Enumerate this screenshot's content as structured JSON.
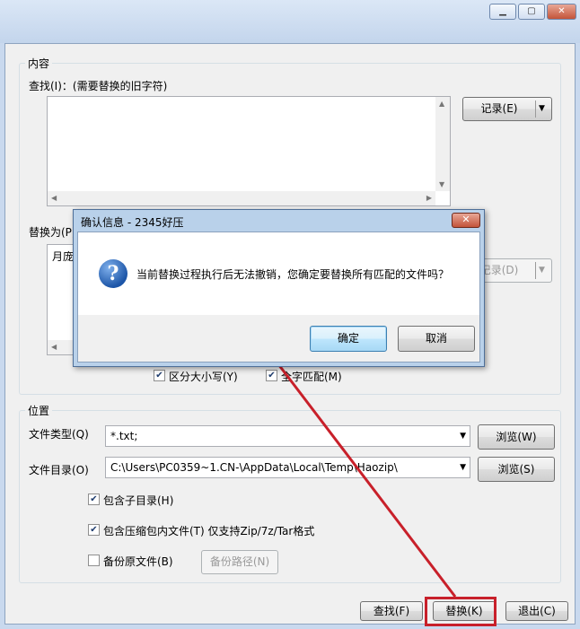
{
  "window": {
    "minimize_glyph": "▁",
    "maximize_glyph": "▢",
    "close_glyph": "✕"
  },
  "content": {
    "group_title": "内容",
    "find_label": "查找(I)：(需要替换的旧字符)",
    "find_history_button": "记录(E)",
    "replace_label": "替换为(P)",
    "replace_value": "月庞",
    "replace_history_button": "记录(D)",
    "case_sensitive_label": "区分大小写(Y)",
    "case_sensitive_checked": true,
    "whole_word_label": "全字匹配(M)",
    "whole_word_checked": true
  },
  "location": {
    "group_title": "位置",
    "file_type_label": "文件类型(Q)",
    "file_type_value": "*.txt;",
    "browse_type_button": "浏览(W)",
    "file_dir_label": "文件目录(O)",
    "file_dir_value": "C:\\Users\\PC0359~1.CN-\\AppData\\Local\\Temp\\Haozip\\",
    "browse_dir_button": "浏览(S)",
    "include_subdirs_label": "包含子目录(H)",
    "include_subdirs_checked": true,
    "include_archives_label": "包含压缩包内文件(T) 仅支持Zip/7z/Tar格式",
    "include_archives_checked": true,
    "backup_label": "备份原文件(B)",
    "backup_checked": false,
    "backup_path_button": "备份路径(N)"
  },
  "footer": {
    "find_button": "查找(F)",
    "replace_button": "替换(K)",
    "exit_button": "退出(C)"
  },
  "dialog": {
    "title": "确认信息 - 2345好压",
    "message": "当前替换过程执行后无法撤销，您确定要替换所有匹配的文件吗？",
    "ok_button": "确定",
    "cancel_button": "取消",
    "icon": "question-icon"
  },
  "annotation": {
    "arrow_color": "#c8202a",
    "highlight_color": "#c8202a"
  }
}
